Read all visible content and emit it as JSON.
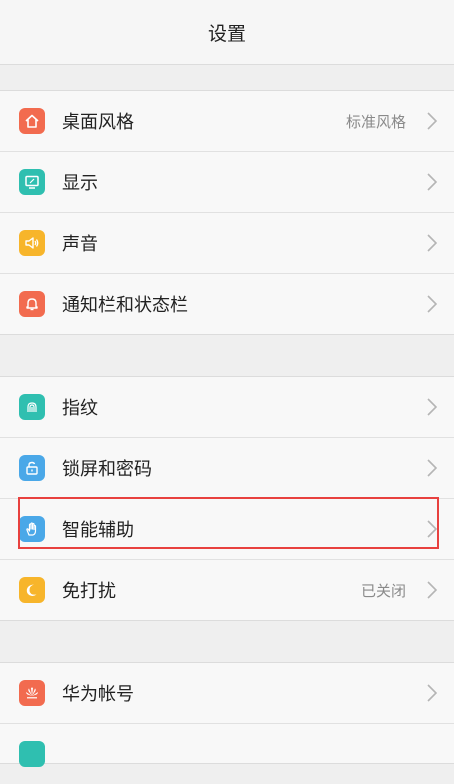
{
  "header": {
    "title": "设置"
  },
  "groups": [
    {
      "items": [
        {
          "label": "桌面风格",
          "value": "标准风格",
          "icon": "home-icon",
          "color": "#f26b4f"
        },
        {
          "label": "显示",
          "value": "",
          "icon": "display-icon",
          "color": "#2fbfb0"
        },
        {
          "label": "声音",
          "value": "",
          "icon": "sound-icon",
          "color": "#f7b52b"
        },
        {
          "label": "通知栏和状态栏",
          "value": "",
          "icon": "bell-icon",
          "color": "#f26b4f"
        }
      ]
    },
    {
      "items": [
        {
          "label": "指纹",
          "value": "",
          "icon": "fingerprint-icon",
          "color": "#2fbfb0"
        },
        {
          "label": "锁屏和密码",
          "value": "",
          "icon": "lock-icon",
          "color": "#4aa8e8"
        },
        {
          "label": "智能辅助",
          "value": "",
          "icon": "hand-icon",
          "color": "#4aa8e8"
        },
        {
          "label": "免打扰",
          "value": "已关闭",
          "icon": "moon-icon",
          "color": "#f7b52b"
        }
      ]
    },
    {
      "items": [
        {
          "label": "华为帐号",
          "value": "",
          "icon": "huawei-icon",
          "color": "#f26b4f"
        }
      ]
    }
  ]
}
